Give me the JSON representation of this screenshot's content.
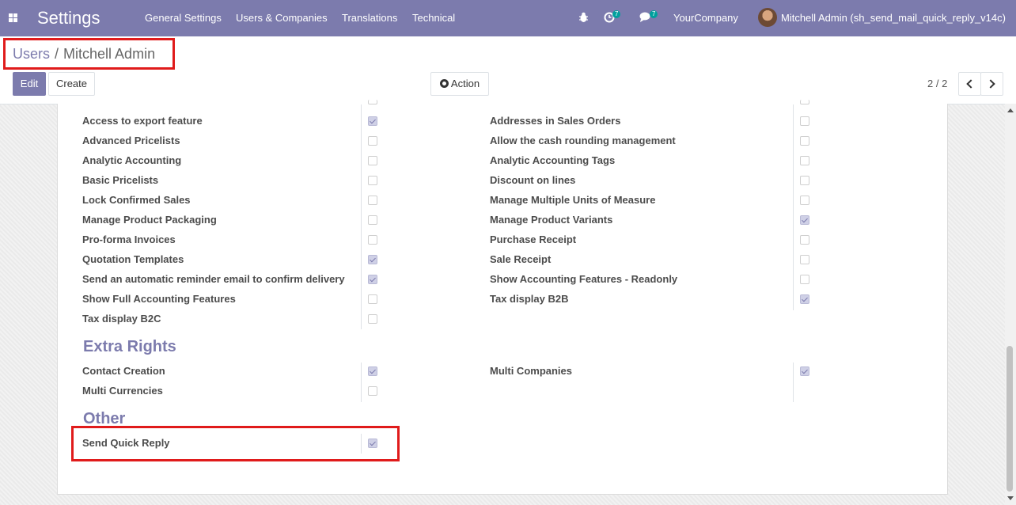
{
  "navbar": {
    "app_title": "Settings",
    "menu": [
      "General Settings",
      "Users & Companies",
      "Translations",
      "Technical"
    ],
    "activity_count": "7",
    "message_count": "7",
    "company": "YourCompany",
    "user": "Mitchell Admin (sh_send_mail_quick_reply_v14c)"
  },
  "breadcrumb": {
    "parent": "Users",
    "separator": "/",
    "current": "Mitchell Admin"
  },
  "toolbar": {
    "edit_label": "Edit",
    "create_label": "Create",
    "action_label": "Action"
  },
  "pager": {
    "value": "2 / 2"
  },
  "access_rights": {
    "left": [
      {
        "label": "Access to export feature",
        "checked": true
      },
      {
        "label": "Advanced Pricelists",
        "checked": false
      },
      {
        "label": "Analytic Accounting",
        "checked": false
      },
      {
        "label": "Basic Pricelists",
        "checked": false
      },
      {
        "label": "Lock Confirmed Sales",
        "checked": false
      },
      {
        "label": "Manage Product Packaging",
        "checked": false
      },
      {
        "label": "Pro-forma Invoices",
        "checked": false
      },
      {
        "label": "Quotation Templates",
        "checked": true
      },
      {
        "label": "Send an automatic reminder email to confirm delivery",
        "checked": true
      },
      {
        "label": "Show Full Accounting Features",
        "checked": false
      },
      {
        "label": "Tax display B2C",
        "checked": false
      }
    ],
    "right": [
      {
        "label": "Addresses in Sales Orders",
        "checked": false
      },
      {
        "label": "Allow the cash rounding management",
        "checked": false
      },
      {
        "label": "Analytic Accounting Tags",
        "checked": false
      },
      {
        "label": "Discount on lines",
        "checked": false
      },
      {
        "label": "Manage Multiple Units of Measure",
        "checked": false
      },
      {
        "label": "Manage Product Variants",
        "checked": true
      },
      {
        "label": "Purchase Receipt",
        "checked": false
      },
      {
        "label": "Sale Receipt",
        "checked": false
      },
      {
        "label": "Show Accounting Features - Readonly",
        "checked": false
      },
      {
        "label": "Tax display B2B",
        "checked": true
      }
    ]
  },
  "extra_rights": {
    "title": "Extra Rights",
    "left": [
      {
        "label": "Contact Creation",
        "checked": true
      },
      {
        "label": "Multi Currencies",
        "checked": false
      }
    ],
    "right": [
      {
        "label": "Multi Companies",
        "checked": true
      }
    ]
  },
  "other": {
    "title": "Other",
    "items": [
      {
        "label": "Send Quick Reply",
        "checked": true
      }
    ]
  },
  "colors": {
    "brand": "#7c7bad",
    "highlight": "#e01b1b",
    "badge": "#00a09d"
  }
}
